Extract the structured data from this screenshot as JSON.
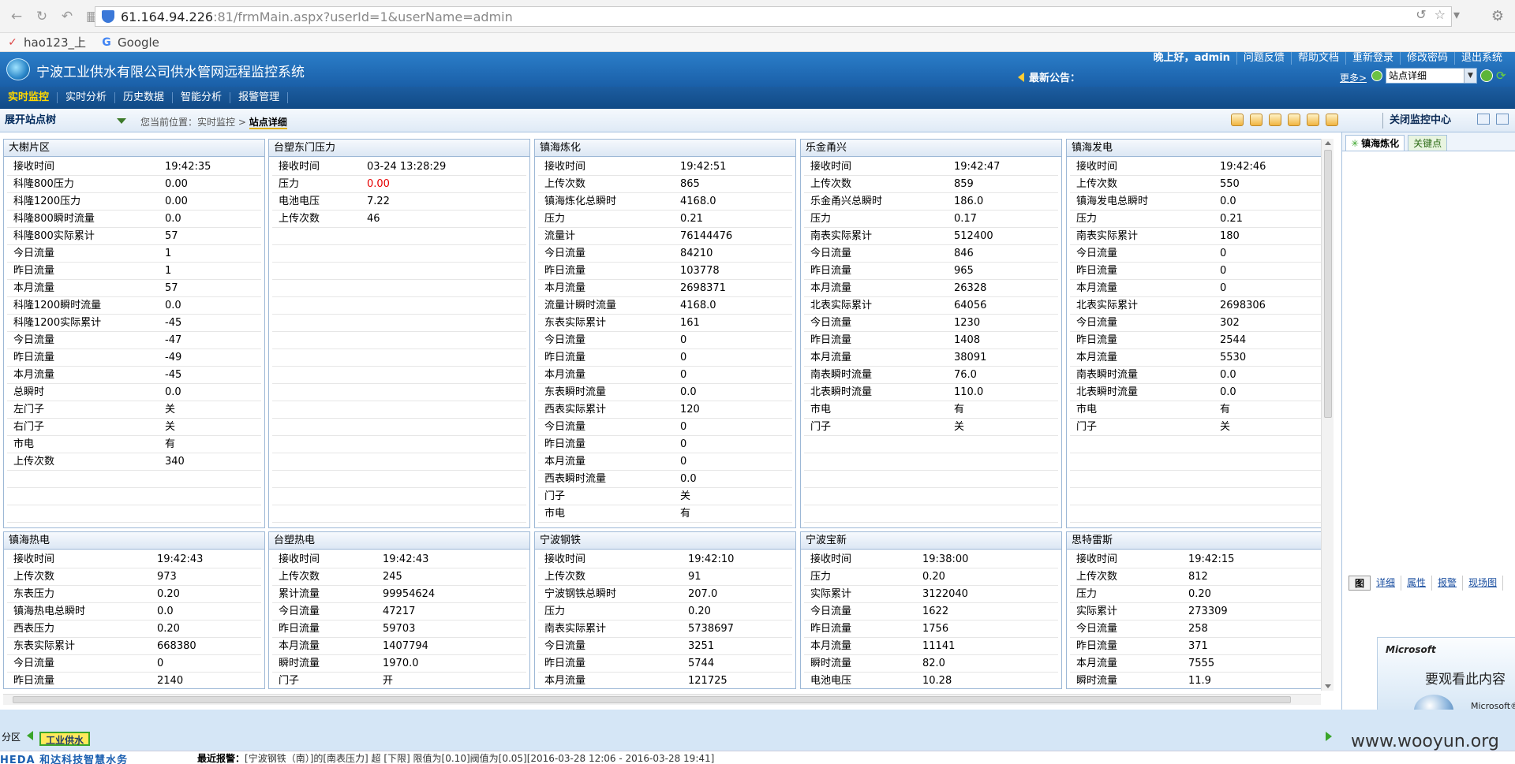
{
  "browser": {
    "url_host": "61.164.94.226",
    "url_path": ":81/frmMain.aspx?userId=1&userName=admin",
    "bookmarks": [
      {
        "label": "hao123_上",
        "icon": "hao123-icon"
      },
      {
        "label": "Google",
        "icon": "google-icon"
      }
    ]
  },
  "header": {
    "title": "宁波工业供水有限公司供水管网远程监控系统",
    "links": [
      "晚上好，admin",
      "问题反馈",
      "帮助文档",
      "重新登录",
      "修改密码",
      "退出系统"
    ],
    "notice_label": "最新公告：",
    "more_label": "更多>",
    "site_select_value": "站点详细"
  },
  "menu": [
    "实时监控",
    "实时分析",
    "历史数据",
    "智能分析",
    "报警管理"
  ],
  "toolbar": {
    "tree_toggle": "展开站点树",
    "breadcrumb_prefix": "您当前位置：实时监控 > ",
    "breadcrumb_current": "站点详细",
    "close_center": "关闭监控中心"
  },
  "panels": [
    {
      "title": "大榭片区",
      "rows": [
        [
          "接收时间",
          "19:42:35"
        ],
        [
          "科隆800压力",
          "0.00"
        ],
        [
          "科隆1200压力",
          "0.00"
        ],
        [
          "科隆800瞬时流量",
          "0.0"
        ],
        [
          "科隆800实际累计",
          "57"
        ],
        [
          "今日流量",
          "1"
        ],
        [
          "昨日流量",
          "1"
        ],
        [
          "本月流量",
          "57"
        ],
        [
          "科隆1200瞬时流量",
          "0.0"
        ],
        [
          "科隆1200实际累计",
          "-45"
        ],
        [
          "今日流量",
          "-47"
        ],
        [
          "昨日流量",
          "-49"
        ],
        [
          "本月流量",
          "-45"
        ],
        [
          "总瞬时",
          "0.0"
        ],
        [
          "左门子",
          "关"
        ],
        [
          "右门子",
          "关"
        ],
        [
          "市电",
          "有"
        ],
        [
          "上传次数",
          "340"
        ]
      ]
    },
    {
      "title": "台塑东门压力",
      "rows": [
        [
          "接收时间",
          "03-24 13:28:29"
        ],
        [
          "压力",
          "0.00"
        ],
        [
          "电池电压",
          "7.22"
        ],
        [
          "上传次数",
          "46"
        ]
      ]
    },
    {
      "title": "镇海炼化",
      "rows": [
        [
          "接收时间",
          "19:42:51"
        ],
        [
          "上传次数",
          "865"
        ],
        [
          "镇海炼化总瞬时",
          "4168.0"
        ],
        [
          "压力",
          "0.21"
        ],
        [
          "流量计",
          "76144476"
        ],
        [
          "今日流量",
          "84210"
        ],
        [
          "昨日流量",
          "103778"
        ],
        [
          "本月流量",
          "2698371"
        ],
        [
          "流量计瞬时流量",
          "4168.0"
        ],
        [
          "东表实际累计",
          "161"
        ],
        [
          "今日流量",
          "0"
        ],
        [
          "昨日流量",
          "0"
        ],
        [
          "本月流量",
          "0"
        ],
        [
          "东表瞬时流量",
          "0.0"
        ],
        [
          "西表实际累计",
          "120"
        ],
        [
          "今日流量",
          "0"
        ],
        [
          "昨日流量",
          "0"
        ],
        [
          "本月流量",
          "0"
        ],
        [
          "西表瞬时流量",
          "0.0"
        ],
        [
          "门子",
          "关"
        ],
        [
          "市电",
          "有"
        ]
      ]
    },
    {
      "title": "乐金甬兴",
      "rows": [
        [
          "接收时间",
          "19:42:47"
        ],
        [
          "上传次数",
          "859"
        ],
        [
          "乐金甬兴总瞬时",
          "186.0"
        ],
        [
          "压力",
          "0.17"
        ],
        [
          "南表实际累计",
          "512400"
        ],
        [
          "今日流量",
          "846"
        ],
        [
          "昨日流量",
          "965"
        ],
        [
          "本月流量",
          "26328"
        ],
        [
          "北表实际累计",
          "64056"
        ],
        [
          "今日流量",
          "1230"
        ],
        [
          "昨日流量",
          "1408"
        ],
        [
          "本月流量",
          "38091"
        ],
        [
          "南表瞬时流量",
          "76.0"
        ],
        [
          "北表瞬时流量",
          "110.0"
        ],
        [
          "市电",
          "有"
        ],
        [
          "门子",
          "关"
        ]
      ]
    },
    {
      "title": "镇海发电",
      "rows": [
        [
          "接收时间",
          "19:42:46"
        ],
        [
          "上传次数",
          "550"
        ],
        [
          "镇海发电总瞬时",
          "0.0"
        ],
        [
          "压力",
          "0.21"
        ],
        [
          "南表实际累计",
          "180"
        ],
        [
          "今日流量",
          "0"
        ],
        [
          "昨日流量",
          "0"
        ],
        [
          "本月流量",
          "0"
        ],
        [
          "北表实际累计",
          "2698306"
        ],
        [
          "今日流量",
          "302"
        ],
        [
          "昨日流量",
          "2544"
        ],
        [
          "本月流量",
          "5530"
        ],
        [
          "南表瞬时流量",
          "0.0"
        ],
        [
          "北表瞬时流量",
          "0.0"
        ],
        [
          "市电",
          "有"
        ],
        [
          "门子",
          "关"
        ]
      ]
    },
    {
      "title": "镇海热电",
      "rows": [
        [
          "接收时间",
          "19:42:43"
        ],
        [
          "上传次数",
          "973"
        ],
        [
          "东表压力",
          "0.20"
        ],
        [
          "镇海热电总瞬时",
          "0.0"
        ],
        [
          "西表压力",
          "0.20"
        ],
        [
          "东表实际累计",
          "668380"
        ],
        [
          "今日流量",
          "0"
        ],
        [
          "昨日流量",
          "2140"
        ]
      ]
    },
    {
      "title": "台塑热电",
      "rows": [
        [
          "接收时间",
          "19:42:43"
        ],
        [
          "上传次数",
          "245"
        ],
        [
          "累计流量",
          "99954624"
        ],
        [
          "今日流量",
          "47217"
        ],
        [
          "昨日流量",
          "59703"
        ],
        [
          "本月流量",
          "1407794"
        ],
        [
          "瞬时流量",
          "1970.0"
        ],
        [
          "门子",
          "开"
        ]
      ]
    },
    {
      "title": "宁波钢铁",
      "rows": [
        [
          "接收时间",
          "19:42:10"
        ],
        [
          "上传次数",
          "91"
        ],
        [
          "宁波钢铁总瞬时",
          "207.0"
        ],
        [
          "压力",
          "0.20"
        ],
        [
          "南表实际累计",
          "5738697"
        ],
        [
          "今日流量",
          "3251"
        ],
        [
          "昨日流量",
          "5744"
        ],
        [
          "本月流量",
          "121725"
        ]
      ]
    },
    {
      "title": "宁波宝新",
      "rows": [
        [
          "接收时间",
          "19:38:00"
        ],
        [
          "压力",
          "0.20"
        ],
        [
          "实际累计",
          "3122040"
        ],
        [
          "今日流量",
          "1622"
        ],
        [
          "昨日流量",
          "1756"
        ],
        [
          "本月流量",
          "11141"
        ],
        [
          "瞬时流量",
          "82.0"
        ],
        [
          "电池电压",
          "10.28"
        ]
      ]
    },
    {
      "title": "思特雷斯",
      "rows": [
        [
          "接收时间",
          "19:42:15"
        ],
        [
          "上传次数",
          "812"
        ],
        [
          "压力",
          "0.20"
        ],
        [
          "实际累计",
          "273309"
        ],
        [
          "今日流量",
          "258"
        ],
        [
          "昨日流量",
          "371"
        ],
        [
          "本月流量",
          "7555"
        ],
        [
          "瞬时流量",
          "11.9"
        ]
      ]
    }
  ],
  "right_panel": {
    "tabs": [
      "镇海炼化",
      "关键点"
    ],
    "subtabs": [
      "图",
      "详细",
      "属性",
      "报警",
      "现场图"
    ],
    "silverlight_brand": "Microsoft",
    "silverlight_msg": "要观看此内容",
    "silverlight_brand2": "Microsoft®"
  },
  "bottom": {
    "zone_label": "分区",
    "zone_tab": "工业供水",
    "watermark": "www.wooyun.org",
    "company": "HEDA 和达科技智慧水务",
    "alarm_label": "最近报警：",
    "alarm_text": "[宁波钢铁（南）]的[南表压力] 超 [下限] 限值为[0.10]阀值为[0.05][2016-03-28 12:06 - 2016-03-28 19:41]"
  },
  "colors": {
    "header_blue": "#1a5fa8",
    "menu_active": "#ffd700",
    "alarm_red": "#e60000"
  }
}
